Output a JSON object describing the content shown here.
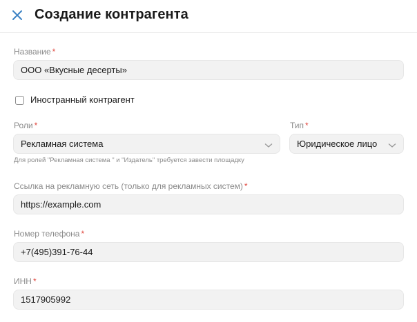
{
  "header": {
    "title": "Создание контрагента"
  },
  "form": {
    "name": {
      "label": "Название",
      "required_mark": "*",
      "value": "ООО «Вкусные десерты»"
    },
    "foreign": {
      "label": "Иностранный контрагент",
      "checked": false
    },
    "roles": {
      "label": "Роли",
      "required_mark": "*",
      "value": "Рекламная система",
      "hint": "Для ролей \"Рекламная система \" и \"Издатель\" требуется завести площадку"
    },
    "type": {
      "label": "Тип",
      "required_mark": "*",
      "value": "Юридическое лицо"
    },
    "ad_network_url": {
      "label": "Ссылка на рекламную сеть (только для рекламных систем)",
      "required_mark": "*",
      "value": "https://example.com"
    },
    "phone": {
      "label": "Номер телефона",
      "required_mark": "*",
      "value": "+7(495)391-76-44"
    },
    "inn": {
      "label": "ИНН",
      "required_mark": "*",
      "value": "1517905992"
    }
  },
  "colors": {
    "accent": "#3b82c4",
    "required": "#e0463d",
    "field_bg": "#f2f2f2",
    "label": "#8a8a8a"
  },
  "icons": {
    "close": "close-icon",
    "dropdown": "chevron-down-icon"
  }
}
